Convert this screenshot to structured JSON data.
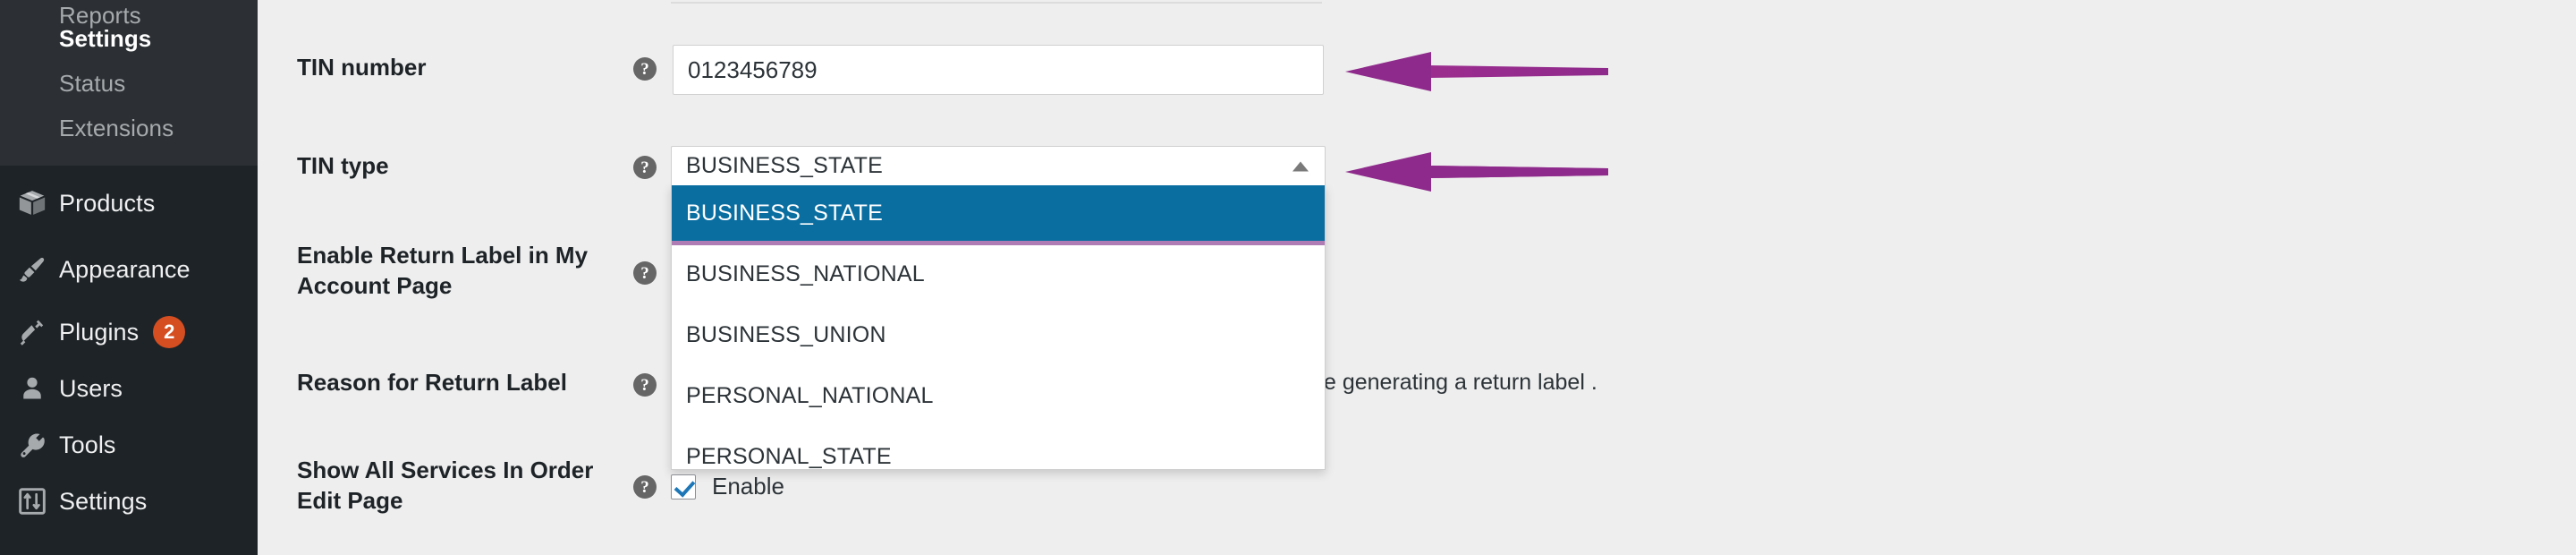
{
  "sidebar": {
    "submenu": [
      {
        "label": "Reports",
        "current": false
      },
      {
        "label": "Settings",
        "current": true
      },
      {
        "label": "Status",
        "current": false
      },
      {
        "label": "Extensions",
        "current": false
      }
    ],
    "menu": [
      {
        "label": "Products",
        "icon": "products-box-icon",
        "badge": null
      },
      {
        "label": "Appearance",
        "icon": "paintbrush-icon",
        "badge": null
      },
      {
        "label": "Plugins",
        "icon": "plug-icon",
        "badge": "2"
      },
      {
        "label": "Users",
        "icon": "user-icon",
        "badge": null
      },
      {
        "label": "Tools",
        "icon": "wrench-icon",
        "badge": null
      },
      {
        "label": "Settings",
        "icon": "sliders-icon",
        "badge": null
      }
    ],
    "badge_color": "#d54e21"
  },
  "form": {
    "rows": [
      {
        "label": "TIN number",
        "help": "?"
      },
      {
        "label": "TIN type",
        "help": "?"
      },
      {
        "label": "Enable Return Label in My Account Page",
        "help": "?"
      },
      {
        "label": "Reason for Return Label",
        "help": "?"
      },
      {
        "label": "Show All Services In Order Edit Page",
        "help": "?"
      }
    ],
    "tin_number": {
      "value": "0123456789",
      "placeholder": ""
    },
    "tin_type": {
      "selected": "BUSINESS_STATE",
      "expanded": true,
      "caret": "chevron-up-icon",
      "options": [
        "BUSINESS_STATE",
        "BUSINESS_NATIONAL",
        "BUSINESS_UNION",
        "PERSONAL_NATIONAL",
        "PERSONAL_STATE"
      ],
      "highlight_color": "#0b6ea1",
      "separator_color": "#b07cb4"
    },
    "reason_text_visible": "e generating a return label .",
    "show_all_services": {
      "checkbox_label": "Enable",
      "checked": true
    }
  },
  "annotations": {
    "arrow_color": "#8e2a8b",
    "arrows": [
      {
        "name": "arrow-to-tin-number"
      },
      {
        "name": "arrow-to-tin-type"
      }
    ]
  }
}
